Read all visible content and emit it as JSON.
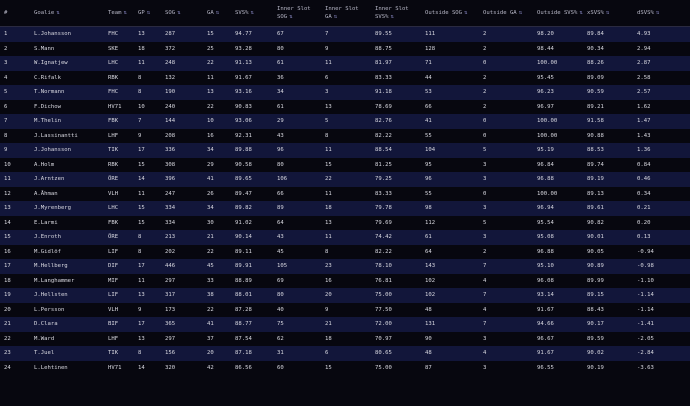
{
  "columns": [
    "#",
    "Goalie",
    "Team",
    "GP",
    "SOG",
    "GA",
    "SVS%",
    "Inner Slot SOG",
    "Inner Slot GA",
    "Inner Slot SVS%",
    "Outside SOG",
    "Outside GA",
    "Outside SVS%",
    "xSVS%",
    "dSVS%"
  ],
  "sort_icon": "⇅",
  "rows": [
    [
      "1",
      "L.Johansson",
      "FHC",
      "13",
      "287",
      "15",
      "94.77",
      "67",
      "7",
      "89.55",
      "111",
      "2",
      "98.20",
      "89.84",
      "4.93"
    ],
    [
      "2",
      "S.Mann",
      "SKE",
      "18",
      "372",
      "25",
      "93.28",
      "80",
      "9",
      "88.75",
      "128",
      "2",
      "98.44",
      "90.34",
      "2.94"
    ],
    [
      "3",
      "W.Ignatjew",
      "LHC",
      "11",
      "248",
      "22",
      "91.13",
      "61",
      "11",
      "81.97",
      "71",
      "0",
      "100.00",
      "88.26",
      "2.87"
    ],
    [
      "4",
      "C.Rifalk",
      "RBK",
      "8",
      "132",
      "11",
      "91.67",
      "36",
      "6",
      "83.33",
      "44",
      "2",
      "95.45",
      "89.09",
      "2.58"
    ],
    [
      "5",
      "T.Normann",
      "FHC",
      "8",
      "190",
      "13",
      "93.16",
      "34",
      "3",
      "91.18",
      "53",
      "2",
      "96.23",
      "90.59",
      "2.57"
    ],
    [
      "6",
      "F.Dichow",
      "HV71",
      "10",
      "240",
      "22",
      "90.83",
      "61",
      "13",
      "78.69",
      "66",
      "2",
      "96.97",
      "89.21",
      "1.62"
    ],
    [
      "7",
      "M.Thelin",
      "FBK",
      "7",
      "144",
      "10",
      "93.06",
      "29",
      "5",
      "82.76",
      "41",
      "0",
      "100.00",
      "91.58",
      "1.47"
    ],
    [
      "8",
      "J.Lassinantti",
      "LHF",
      "9",
      "208",
      "16",
      "92.31",
      "43",
      "8",
      "82.22",
      "55",
      "0",
      "100.00",
      "90.88",
      "1.43"
    ],
    [
      "9",
      "J.Johansson",
      "TIK",
      "17",
      "336",
      "34",
      "89.88",
      "96",
      "11",
      "88.54",
      "104",
      "5",
      "95.19",
      "88.53",
      "1.36"
    ],
    [
      "10",
      "A.Holm",
      "RBK",
      "15",
      "308",
      "29",
      "90.58",
      "80",
      "15",
      "81.25",
      "95",
      "3",
      "96.84",
      "89.74",
      "0.84"
    ],
    [
      "11",
      "J.Arntzen",
      "ÖRE",
      "14",
      "396",
      "41",
      "89.65",
      "106",
      "22",
      "79.25",
      "96",
      "3",
      "96.88",
      "89.19",
      "0.46"
    ],
    [
      "12",
      "A.Åhman",
      "VLH",
      "11",
      "247",
      "26",
      "89.47",
      "66",
      "11",
      "83.33",
      "55",
      "0",
      "100.00",
      "89.13",
      "0.34"
    ],
    [
      "13",
      "J.Myrenberg",
      "LHC",
      "15",
      "334",
      "34",
      "89.82",
      "89",
      "18",
      "79.78",
      "98",
      "3",
      "96.94",
      "89.61",
      "0.21"
    ],
    [
      "14",
      "E.Larmi",
      "FBK",
      "15",
      "334",
      "30",
      "91.02",
      "64",
      "13",
      "79.69",
      "112",
      "5",
      "95.54",
      "90.82",
      "0.20"
    ],
    [
      "15",
      "J.Enroth",
      "ÖRE",
      "8",
      "213",
      "21",
      "90.14",
      "43",
      "11",
      "74.42",
      "61",
      "3",
      "95.08",
      "90.01",
      "0.13"
    ],
    [
      "16",
      "M.Gidlöf",
      "LIF",
      "8",
      "202",
      "22",
      "89.11",
      "45",
      "8",
      "82.22",
      "64",
      "2",
      "96.88",
      "90.05",
      "-0.94"
    ],
    [
      "17",
      "M.Hellberg",
      "DIF",
      "17",
      "446",
      "45",
      "89.91",
      "105",
      "23",
      "78.10",
      "143",
      "7",
      "95.10",
      "90.89",
      "-0.98"
    ],
    [
      "18",
      "M.Langhammer",
      "MIF",
      "11",
      "297",
      "33",
      "88.89",
      "69",
      "16",
      "76.81",
      "102",
      "4",
      "96.08",
      "89.99",
      "-1.10"
    ],
    [
      "19",
      "J.Hellsten",
      "LIF",
      "13",
      "317",
      "38",
      "88.01",
      "80",
      "20",
      "75.00",
      "102",
      "7",
      "93.14",
      "89.15",
      "-1.14"
    ],
    [
      "20",
      "L.Persson",
      "VLH",
      "9",
      "173",
      "22",
      "87.28",
      "40",
      "9",
      "77.50",
      "48",
      "4",
      "91.67",
      "88.43",
      "-1.14"
    ],
    [
      "21",
      "D.Clara",
      "BIF",
      "17",
      "365",
      "41",
      "88.77",
      "75",
      "21",
      "72.00",
      "131",
      "7",
      "94.66",
      "90.17",
      "-1.41"
    ],
    [
      "22",
      "M.Ward",
      "LHF",
      "13",
      "297",
      "37",
      "87.54",
      "62",
      "18",
      "70.97",
      "90",
      "3",
      "96.67",
      "89.59",
      "-2.05"
    ],
    [
      "23",
      "T.Juel",
      "TIK",
      "8",
      "156",
      "20",
      "87.18",
      "31",
      "6",
      "80.65",
      "48",
      "4",
      "91.67",
      "90.02",
      "-2.84"
    ],
    [
      "24",
      "L.Lehtinen",
      "HV71",
      "14",
      "320",
      "42",
      "86.56",
      "60",
      "15",
      "75.00",
      "87",
      "3",
      "96.55",
      "90.19",
      "-3.63"
    ]
  ]
}
